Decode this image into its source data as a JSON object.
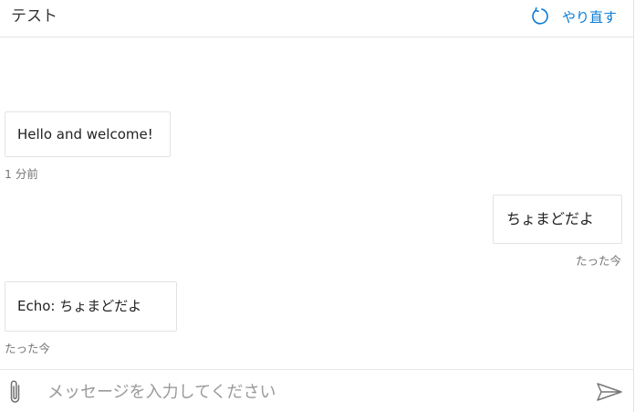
{
  "header": {
    "title": "テスト",
    "restart_label": "やり直す",
    "restart_icon": "refresh-icon"
  },
  "messages": [
    {
      "from": "bot",
      "text": "Hello and welcome!",
      "timestamp": "1 分前"
    },
    {
      "from": "user",
      "text": "ちょまどだよ",
      "timestamp": "たった今"
    },
    {
      "from": "bot",
      "text": "Echo: ちょまどだよ",
      "timestamp": "たった今"
    }
  ],
  "composer": {
    "placeholder": "メッセージを入力してください",
    "value": "",
    "attach_icon": "paperclip-icon",
    "send_icon": "send-icon"
  },
  "colors": {
    "accent": "#0a7bd6",
    "timestamp": "#767676",
    "border": "#e3e3e3"
  }
}
